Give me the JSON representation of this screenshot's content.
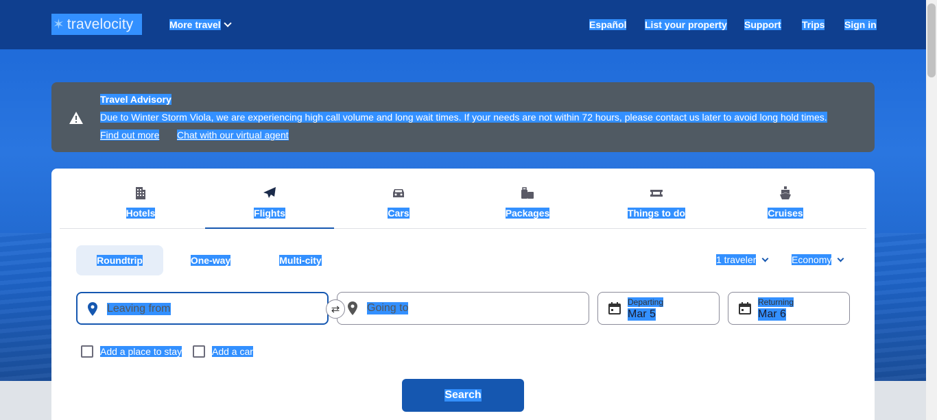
{
  "header": {
    "logo_text": "travelocity",
    "more_travel": "More travel",
    "language": "Español",
    "list_property": "List your property",
    "support": "Support",
    "trips": "Trips",
    "sign_in": "Sign in"
  },
  "advisory": {
    "title": "Travel Advisory",
    "message": "Due to Winter Storm Viola, we are experiencing high call volume and long wait times. If your needs are not within 72 hours, please contact us later to avoid long hold times.",
    "link_find_more": "Find out more",
    "link_chat": "Chat with our virtual agent"
  },
  "tabs": [
    {
      "label": "Hotels",
      "icon": "hotel-icon"
    },
    {
      "label": "Flights",
      "icon": "plane-icon",
      "active": true
    },
    {
      "label": "Cars",
      "icon": "car-icon"
    },
    {
      "label": "Packages",
      "icon": "luggage-icon"
    },
    {
      "label": "Things to do",
      "icon": "ticket-icon"
    },
    {
      "label": "Cruises",
      "icon": "ship-icon"
    }
  ],
  "trip_types": {
    "roundtrip": "Roundtrip",
    "oneway": "One-way",
    "multicity": "Multi-city",
    "selected": "Roundtrip"
  },
  "travelers": "1 traveler",
  "cabin_class": "Economy",
  "fields": {
    "leaving_from": "Leaving from",
    "going_to": "Going to",
    "departing_label": "Departing",
    "departing_value": "Mar 5",
    "returning_label": "Returning",
    "returning_value": "Mar 6"
  },
  "addons": {
    "stay": "Add a place to stay",
    "car": "Add a car"
  },
  "search_label": "Search",
  "colors": {
    "brand_dark": "#0f3f8f",
    "primary": "#1557b0",
    "advisory_bg": "#505a63"
  }
}
